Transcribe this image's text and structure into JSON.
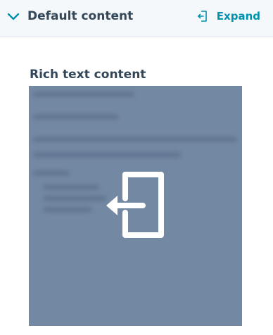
{
  "header": {
    "title": "Default content",
    "expand_label": "Expand",
    "chevron_icon": "chevron-down-icon",
    "expand_icon": "expand-icon"
  },
  "section": {
    "title": "Rich text content"
  },
  "preview": {
    "overlay_icon": "expand-icon"
  },
  "colors": {
    "header_bg": "#f5f8fa",
    "title_text": "#33475b",
    "accent": "#0091ae",
    "preview_bg": "#7388a2",
    "icon": "#ffffff"
  }
}
